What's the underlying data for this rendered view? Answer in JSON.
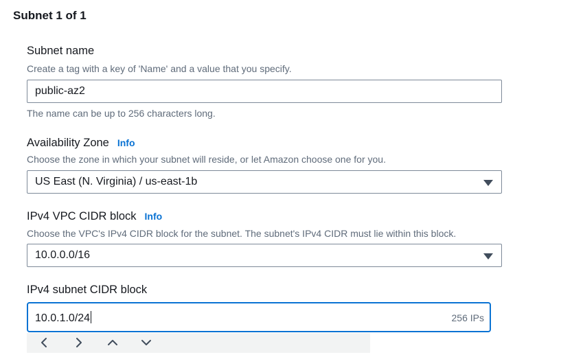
{
  "section": {
    "title": "Subnet 1 of 1"
  },
  "subnet_name": {
    "label": "Subnet name",
    "description": "Create a tag with a key of 'Name' and a value that you specify.",
    "value": "public-az2",
    "constraint": "The name can be up to 256 characters long."
  },
  "availability_zone": {
    "label": "Availability Zone",
    "info": "Info",
    "description": "Choose the zone in which your subnet will reside, or let Amazon choose one for you.",
    "selected": "US East (N. Virginia) / us-east-1b"
  },
  "vpc_cidr": {
    "label": "IPv4 VPC CIDR block",
    "info": "Info",
    "description": "Choose the VPC's IPv4 CIDR block for the subnet. The subnet's IPv4 CIDR must lie within this block.",
    "selected": "10.0.0.0/16"
  },
  "subnet_cidr": {
    "label": "IPv4 subnet CIDR block",
    "value": "10.0.1.0/24",
    "ip_count": "256 IPs"
  },
  "icons": {
    "previous": "chevron-left-icon",
    "next": "chevron-right-icon",
    "increment": "chevron-up-icon",
    "decrement": "chevron-down-icon",
    "dropdown": "caret-down-icon"
  },
  "colors": {
    "link": "#0972d3",
    "focus_border": "#0972d3",
    "text": "#16191f",
    "muted": "#5f6b7a"
  }
}
